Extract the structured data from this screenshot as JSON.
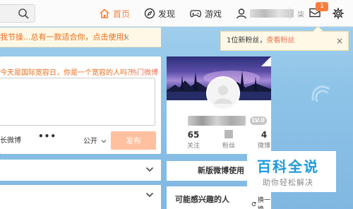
{
  "nav": {
    "home_label": "首页",
    "discover_label": "发现",
    "game_label": "游戏",
    "user_tail": "柒",
    "message_badge": "1"
  },
  "notice": {
    "text": "我节操...总有一款适合你，点击使用!",
    "close_label": "×"
  },
  "fan_tip": {
    "prefix": "1位新粉丝，",
    "link": "查看粉丝",
    "close_label": "×"
  },
  "composer": {
    "prompt": "今天是国际宽容日，你是一个宽容的人吗？",
    "hot_link": "热门微博",
    "long_weibo_label": "长微博",
    "more_label": "•••",
    "visibility_label": "公开",
    "publish_label": "发布"
  },
  "profile": {
    "level_badge": "LV.0",
    "follow_count": "65",
    "follow_label": "关注",
    "fans_label": "粉丝",
    "posts_count": "4",
    "posts_label": "微博"
  },
  "edition": {
    "title": "新版微博使用"
  },
  "interest": {
    "title": "可能感兴趣的人",
    "refresh_label": "换一换"
  },
  "watermark": {
    "title": "百科全说",
    "subtitle": "助你轻松解决"
  },
  "colors": {
    "accent": "#fa7d3c",
    "link": "#eb7350",
    "publish_disabled": "#ffc09f",
    "background": "#8fc4e8",
    "watermark_blue": "#1e9ad8"
  }
}
